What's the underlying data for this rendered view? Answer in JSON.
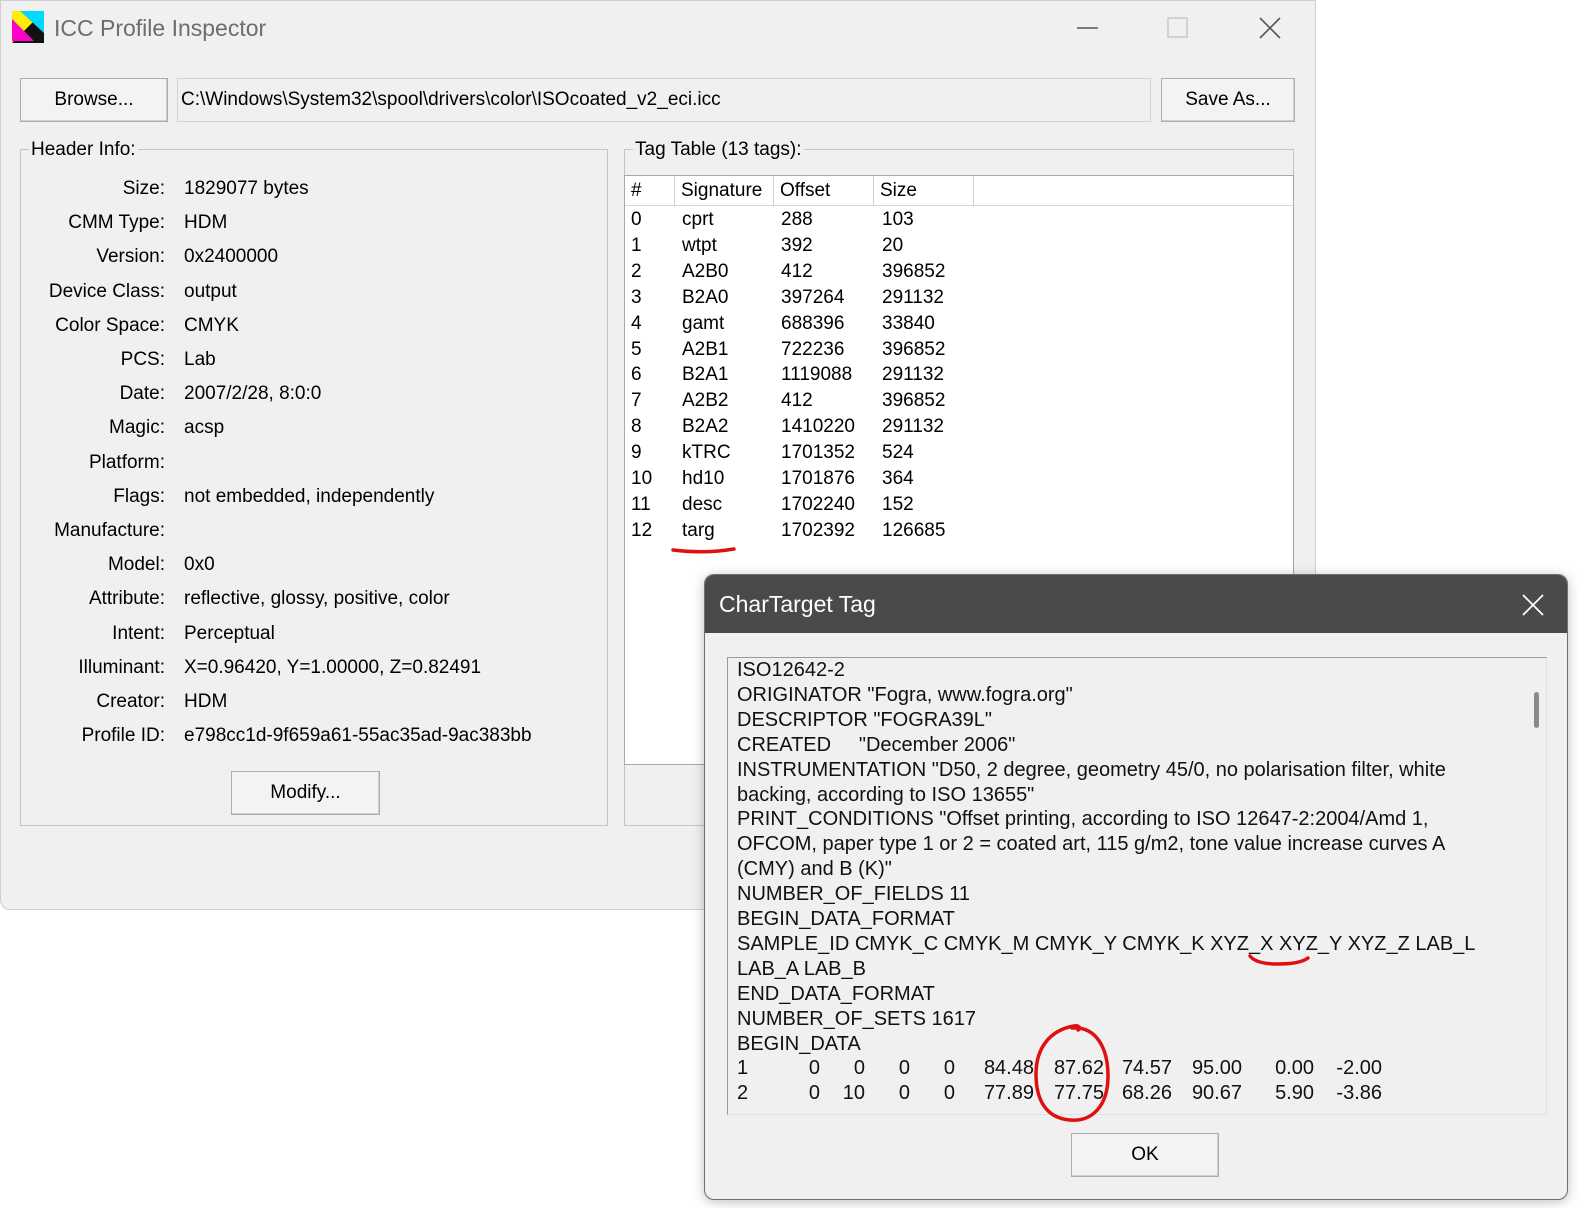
{
  "window": {
    "title": "ICC Profile Inspector",
    "buttons": {
      "browse": "Browse...",
      "save_as": "Save As...",
      "modify": "Modify..."
    },
    "file_path": "C:\\Windows\\System32\\spool\\drivers\\color\\ISOcoated_v2_eci.icc"
  },
  "header_info": {
    "title": "Header Info:",
    "fields": [
      {
        "label": "Size:",
        "value": "1829077 bytes"
      },
      {
        "label": "CMM Type:",
        "value": "HDM"
      },
      {
        "label": "Version:",
        "value": "0x2400000"
      },
      {
        "label": "Device Class:",
        "value": "output"
      },
      {
        "label": "Color Space:",
        "value": "CMYK"
      },
      {
        "label": "PCS:",
        "value": "Lab"
      },
      {
        "label": "Date:",
        "value": "2007/2/28, 8:0:0"
      },
      {
        "label": "Magic:",
        "value": "acsp"
      },
      {
        "label": "Platform:",
        "value": ""
      },
      {
        "label": "Flags:",
        "value": "not embedded, independently"
      },
      {
        "label": "Manufacture:",
        "value": ""
      },
      {
        "label": "Model:",
        "value": "0x0"
      },
      {
        "label": "Attribute:",
        "value": "reflective, glossy, positive, color"
      },
      {
        "label": "Intent:",
        "value": "Perceptual"
      },
      {
        "label": "Illuminant:",
        "value": "X=0.96420, Y=1.00000, Z=0.82491"
      },
      {
        "label": "Creator:",
        "value": "HDM"
      },
      {
        "label": "Profile ID:",
        "value": "e798cc1d-9f659a61-55ac35ad-9ac383bb"
      }
    ]
  },
  "tag_table": {
    "title": "Tag Table (13 tags):",
    "columns": [
      "#",
      "Signature",
      "Offset",
      "Size"
    ],
    "rows": [
      [
        "0",
        "cprt",
        "288",
        "103"
      ],
      [
        "1",
        "wtpt",
        "392",
        "20"
      ],
      [
        "2",
        "A2B0",
        "412",
        "396852"
      ],
      [
        "3",
        "B2A0",
        "397264",
        "291132"
      ],
      [
        "4",
        "gamt",
        "688396",
        "33840"
      ],
      [
        "5",
        "A2B1",
        "722236",
        "396852"
      ],
      [
        "6",
        "B2A1",
        "1119088",
        "291132"
      ],
      [
        "7",
        "A2B2",
        "412",
        "396852"
      ],
      [
        "8",
        "B2A2",
        "1410220",
        "291132"
      ],
      [
        "9",
        "kTRC",
        "1701352",
        "524"
      ],
      [
        "10",
        "hd10",
        "1701876",
        "364"
      ],
      [
        "11",
        "desc",
        "1702240",
        "152"
      ],
      [
        "12",
        "targ",
        "1702392",
        "126685"
      ]
    ]
  },
  "dialog": {
    "title": "CharTarget Tag",
    "ok_label": "OK",
    "lines": [
      "ISO12642-2",
      "ORIGINATOR \"Fogra, www.fogra.org\"",
      "DESCRIPTOR \"FOGRA39L\"",
      "CREATED     \"December 2006\"",
      "INSTRUMENTATION \"D50, 2 degree, geometry 45/0, no polarisation filter, white",
      "backing, according to ISO 13655\"",
      "PRINT_CONDITIONS \"Offset printing, according to ISO 12647-2:2004/Amd 1,",
      "OFCOM, paper type 1 or 2 = coated art, 115 g/m2, tone value increase curves A",
      "(CMY) and B (K)\"",
      "NUMBER_OF_FIELDS 11",
      "BEGIN_DATA_FORMAT",
      "SAMPLE_ID CMYK_C CMYK_M CMYK_Y CMYK_K XYZ_X XYZ_Y XYZ_Z LAB_L",
      "LAB_A LAB_B",
      "END_DATA_FORMAT",
      "NUMBER_OF_SETS 1617",
      "BEGIN_DATA"
    ],
    "data_rows": [
      [
        "1",
        "0",
        "0",
        "0",
        "0",
        "84.48",
        "87.62",
        "74.57",
        "95.00",
        "0.00",
        "-2.00"
      ],
      [
        "2",
        "0",
        "10",
        "0",
        "0",
        "77.89",
        "77.75",
        "68.26",
        "90.67",
        "5.90",
        "-3.86"
      ]
    ]
  },
  "colors": {
    "window_bg": "#f0f0f0",
    "dialog_titlebar": "#4a4a4a",
    "annotation_red": "#e01010"
  }
}
